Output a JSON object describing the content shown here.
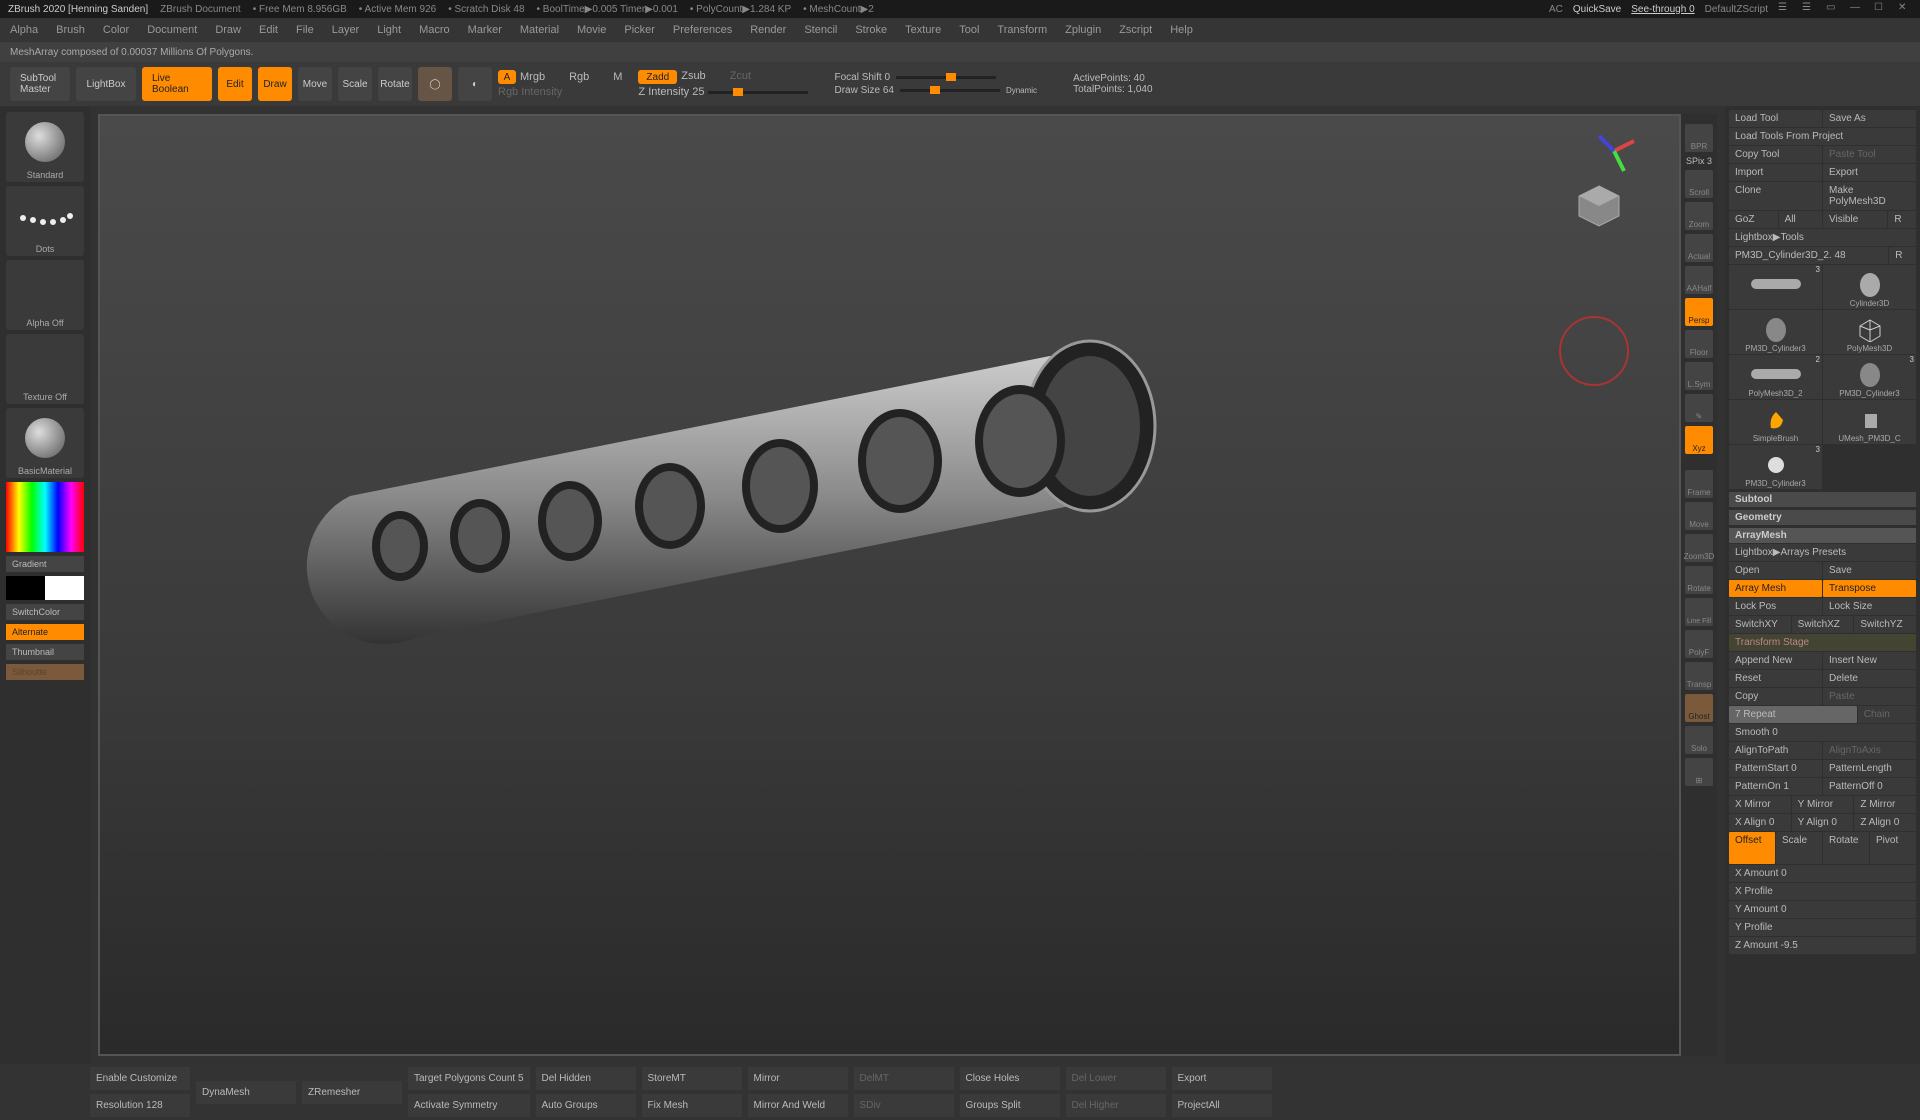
{
  "titlebar": {
    "app": "ZBrush 2020 [Henning Sanden]",
    "doc": "ZBrush Document",
    "freemem": "• Free Mem 8.956GB",
    "activemem": "• Active Mem 926",
    "scratch": "• Scratch Disk 48",
    "booltime": "• BoolTime▶0.005 Timer▶0.001",
    "polycount": "• PolyCount▶1.284 KP",
    "meshcount": "• MeshCount▶2",
    "ac": "AC",
    "quicksave": "QuickSave",
    "seethrough": "See-through  0",
    "zscript": "DefaultZScript"
  },
  "menu": [
    "Alpha",
    "Brush",
    "Color",
    "Document",
    "Draw",
    "Edit",
    "File",
    "Layer",
    "Light",
    "Macro",
    "Marker",
    "Material",
    "Movie",
    "Picker",
    "Preferences",
    "Render",
    "Stencil",
    "Stroke",
    "Texture",
    "Tool",
    "Transform",
    "Zplugin",
    "Zscript",
    "Help"
  ],
  "status": "MeshArray composed of 0.00037 Millions Of Polygons.",
  "toolbar": {
    "subtool": "SubTool\nMaster",
    "lightbox": "LightBox",
    "liveboolean": "Live Boolean",
    "edit": "Edit",
    "draw": "Draw",
    "move": "Move",
    "scale": "Scale",
    "rotate": "Rotate",
    "mrgb": "Mrgb",
    "rgb": "Rgb",
    "m": "M",
    "zadd": "Zadd",
    "zsub": "Zsub",
    "zcut": "Zcut",
    "rgbintensity": "Rgb Intensity",
    "zintensity": "Z Intensity 25",
    "focalshift": "Focal Shift 0",
    "drawsize": "Draw Size 64",
    "dynamic": "Dynamic",
    "activepoints": "ActivePoints: 40",
    "totalpoints": "TotalPoints: 1,040",
    "a_label": "A"
  },
  "left": {
    "brush": "Standard",
    "stroke": "Dots",
    "alpha": "Alpha Off",
    "texture": "Texture Off",
    "material": "BasicMaterial",
    "gradient": "Gradient",
    "switchcolor": "SwitchColor",
    "alternate": "Alternate",
    "thumbnail": "Thumbnail",
    "silhoutte": "Silhoutte"
  },
  "viewtools": {
    "bpr": "BPR",
    "spix": "SPix 3",
    "scroll": "Scroll",
    "zoom": "Zoom",
    "actual": "Actual",
    "aahalf": "AAHalf",
    "persp": "Persp",
    "floor": "Floor",
    "lsym": "L.Sym",
    "xyz": "Xyz",
    "frame": "Frame",
    "move": "Move",
    "zoom3d": "Zoom3D",
    "rotate": "Rotate",
    "linefill": "Line Fill",
    "polyf": "PolyF",
    "transp": "Transp",
    "ghost": "Ghost",
    "solo": "Solo"
  },
  "right": {
    "loadtool": "Load Tool",
    "saveas": "Save As",
    "loadproject": "Load Tools From Project",
    "copytool": "Copy Tool",
    "pastetool": "Paste Tool",
    "import": "Import",
    "export": "Export",
    "clone": "Clone",
    "makepoly": "Make PolyMesh3D",
    "goz": "GoZ",
    "all": "All",
    "visible": "Visible",
    "r": "R",
    "lightboxtools": "Lightbox▶Tools",
    "currenttool": "PM3D_Cylinder3D_2. 48",
    "tools": [
      {
        "name": "",
        "num": "3"
      },
      {
        "name": "Cylinder3D",
        "num": ""
      },
      {
        "name": "PM3D_Cylinder3",
        "num": ""
      },
      {
        "name": "PolyMesh3D",
        "num": ""
      },
      {
        "name": "PolyMesh3D_2",
        "num": "2"
      },
      {
        "name": "PM3D_Cylinder3",
        "num": "3"
      },
      {
        "name": "SimpleBrush",
        "num": ""
      },
      {
        "name": "UMesh_PM3D_C",
        "num": ""
      },
      {
        "name": "PM3D_Cylinder3",
        "num": "3"
      }
    ],
    "subtool": "Subtool",
    "geometry": "Geometry",
    "arraymesh": "ArrayMesh",
    "lightboxarrays": "Lightbox▶Arrays Presets",
    "open": "Open",
    "save": "Save",
    "arraymeshbtn": "Array Mesh",
    "transpose": "Transpose",
    "lockpos": "Lock Pos",
    "locksize": "Lock Size",
    "switchxy": "SwitchXY",
    "switchxz": "SwitchXZ",
    "switchyz": "SwitchYZ",
    "transformstage": "Transform Stage",
    "appendnew": "Append New",
    "insertnew": "Insert New",
    "reset": "Reset",
    "delete": "Delete",
    "copy": "Copy",
    "paste": "Paste",
    "repeat": "7 Repeat",
    "chain": "Chain",
    "smooth": "Smooth 0",
    "aligntopath": "AlignToPath",
    "aligntoaxis": "AlignToAxis",
    "patternstart": "PatternStart 0",
    "patternlength": "PatternLength",
    "patternon": "PatternOn 1",
    "patternoff": "PatternOff 0",
    "xmirror": "X Mirror",
    "ymirror": "Y Mirror",
    "zmirror": "Z Mirror",
    "xalign": "X Align 0",
    "yalign": "Y Align 0",
    "zalign": "Z Align 0",
    "offset": "Offset",
    "scale": "Scale",
    "rotate": "Rotate",
    "pivot": "Pivot",
    "xamount": "X Amount 0",
    "xprofile": "X Profile",
    "yamount": "Y Amount 0",
    "yprofile": "Y Profile",
    "zamount": "Z Amount -9.5"
  },
  "bottom": {
    "enablecustom": "Enable Customize",
    "resolution": "Resolution 128",
    "dynamesh": "DynaMesh",
    "zremesher": "ZRemesher",
    "targetpoly": "Target Polygons Count 5",
    "activatesym": "Activate Symmetry",
    "delhidden": "Del Hidden",
    "autogroups": "Auto Groups",
    "storemt": "StoreMT",
    "fixmesh": "Fix Mesh",
    "mirror": "Mirror",
    "mirrorweld": "Mirror And Weld",
    "delmt": "DelMT",
    "sdiv": "SDiv",
    "closeholes": "Close Holes",
    "groupssplit": "Groups Split",
    "dellower": "Del Lower",
    "delhigher": "Del Higher",
    "export": "Export",
    "projectall": "ProjectAll"
  }
}
